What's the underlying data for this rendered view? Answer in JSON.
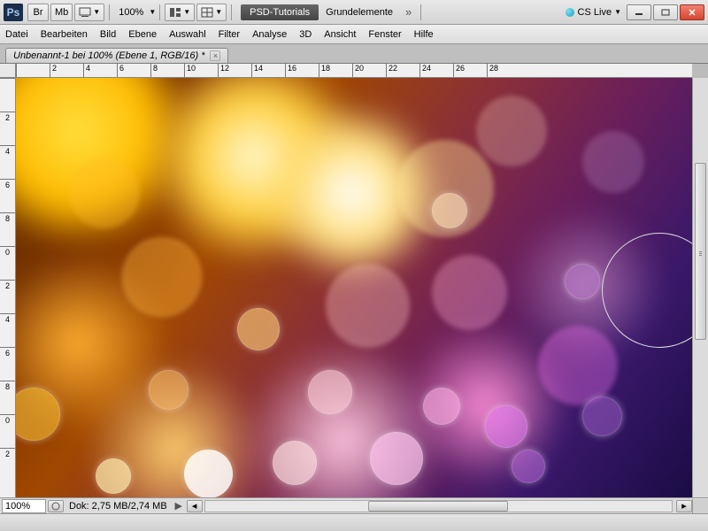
{
  "titlebar": {
    "ps": "Ps",
    "br": "Br",
    "mb": "Mb",
    "zoom": "100%",
    "workspace_btn": "PSD-Tutorials",
    "workspace_alt": "Grundelemente",
    "cs_live": "CS Live"
  },
  "menu": [
    "Datei",
    "Bearbeiten",
    "Bild",
    "Ebene",
    "Auswahl",
    "Filter",
    "Analyse",
    "3D",
    "Ansicht",
    "Fenster",
    "Hilfe"
  ],
  "doc_tab": "Unbenannt-1 bei 100% (Ebene 1, RGB/16) *",
  "ruler_h": [
    "",
    "2",
    "4",
    "6",
    "8",
    "10",
    "12",
    "14",
    "16",
    "18",
    "20",
    "22",
    "24",
    "26",
    "28"
  ],
  "ruler_v": [
    "",
    "2",
    "4",
    "6",
    "8",
    "0",
    "2",
    "4",
    "6",
    "8",
    "0",
    "2"
  ],
  "status": {
    "zoom": "100%",
    "dok": "Dok: 2,75 MB/2,74 MB"
  }
}
